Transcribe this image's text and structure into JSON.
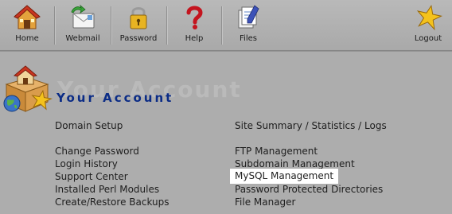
{
  "toolbar": {
    "items": [
      {
        "label": "Home",
        "icon": "home-icon"
      },
      {
        "label": "Webmail",
        "icon": "webmail-icon"
      },
      {
        "label": "Password",
        "icon": "lock-icon"
      },
      {
        "label": "Help",
        "icon": "question-mark-icon"
      },
      {
        "label": "Files",
        "icon": "files-icon"
      },
      {
        "label": "Logout",
        "icon": "star-icon"
      }
    ]
  },
  "header": {
    "title": "Your Account",
    "watermark": "Your Account",
    "logo_icon": "house-box-globe-star-logo"
  },
  "links": {
    "left": [
      "Domain Setup",
      "Change Password",
      "Login History",
      "Support Center",
      "Installed Perl Modules",
      "Create/Restore Backups"
    ],
    "right": [
      "Site Summary / Statistics / Logs",
      "FTP Management",
      "Subdomain Management",
      "MySQL Management",
      "Password Protected Directories",
      "File Manager"
    ]
  },
  "colors": {
    "background": "#adadad",
    "title": "#0b2c86",
    "highlight": "#ffffff"
  }
}
